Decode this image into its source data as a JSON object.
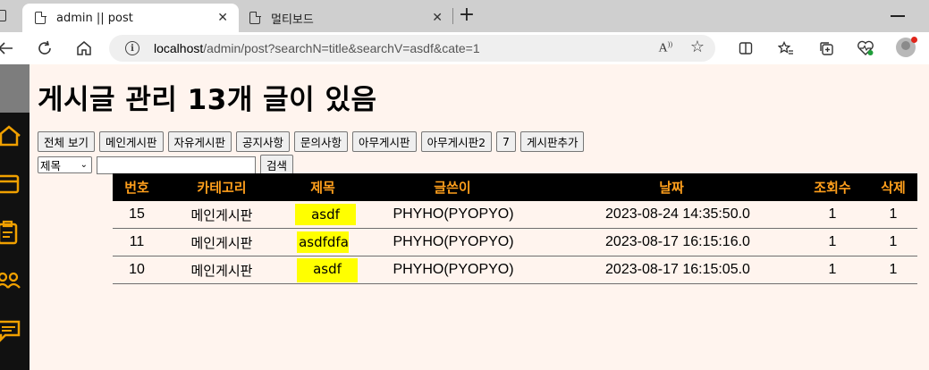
{
  "browser": {
    "tabs": [
      {
        "title": "admin || post",
        "active": true
      },
      {
        "title": "멀티보드",
        "active": false
      }
    ],
    "new_tab_icon": "plus-icon",
    "address": {
      "host": "localhost",
      "path": "/admin/post?searchN=title&searchV=asdf&cate=1"
    }
  },
  "page": {
    "title": "게시글 관리 13개 글이 있음",
    "category_buttons": [
      "전체 보기",
      "메인게시판",
      "자유게시판",
      "공지사항",
      "문의사항",
      "아무게시판",
      "아무게시판2",
      "7",
      "게시판추가"
    ],
    "search": {
      "select_value": "제목",
      "input_value": "",
      "button_label": "검색"
    }
  },
  "table": {
    "headers": [
      "번호",
      "카테고리",
      "제목",
      "글쓴이",
      "날짜",
      "조회수",
      "삭제"
    ],
    "rows": [
      {
        "no": "15",
        "category": "메인게시판",
        "title": "asdf",
        "writer": "PHYHO(PYOPYO)",
        "date": "2023-08-24 14:35:50.0",
        "views": "1",
        "delete": "1"
      },
      {
        "no": "11",
        "category": "메인게시판",
        "title": "asdfdfa",
        "writer": "PHYHO(PYOPYO)",
        "date": "2023-08-17 16:15:16.0",
        "views": "1",
        "delete": "1"
      },
      {
        "no": "10",
        "category": "메인게시판",
        "title": "asdf",
        "writer": "PHYHO(PYOPYO)",
        "date": "2023-08-17 16:15:05.0",
        "views": "1",
        "delete": "1"
      }
    ]
  },
  "colors": {
    "page_bg": "#fff4ee",
    "header_bg": "#000000",
    "header_text": "#ff9f1c",
    "sidebar_bg": "#111111",
    "sidebar_icon": "#f0a000",
    "highlight": "#ffff00"
  }
}
